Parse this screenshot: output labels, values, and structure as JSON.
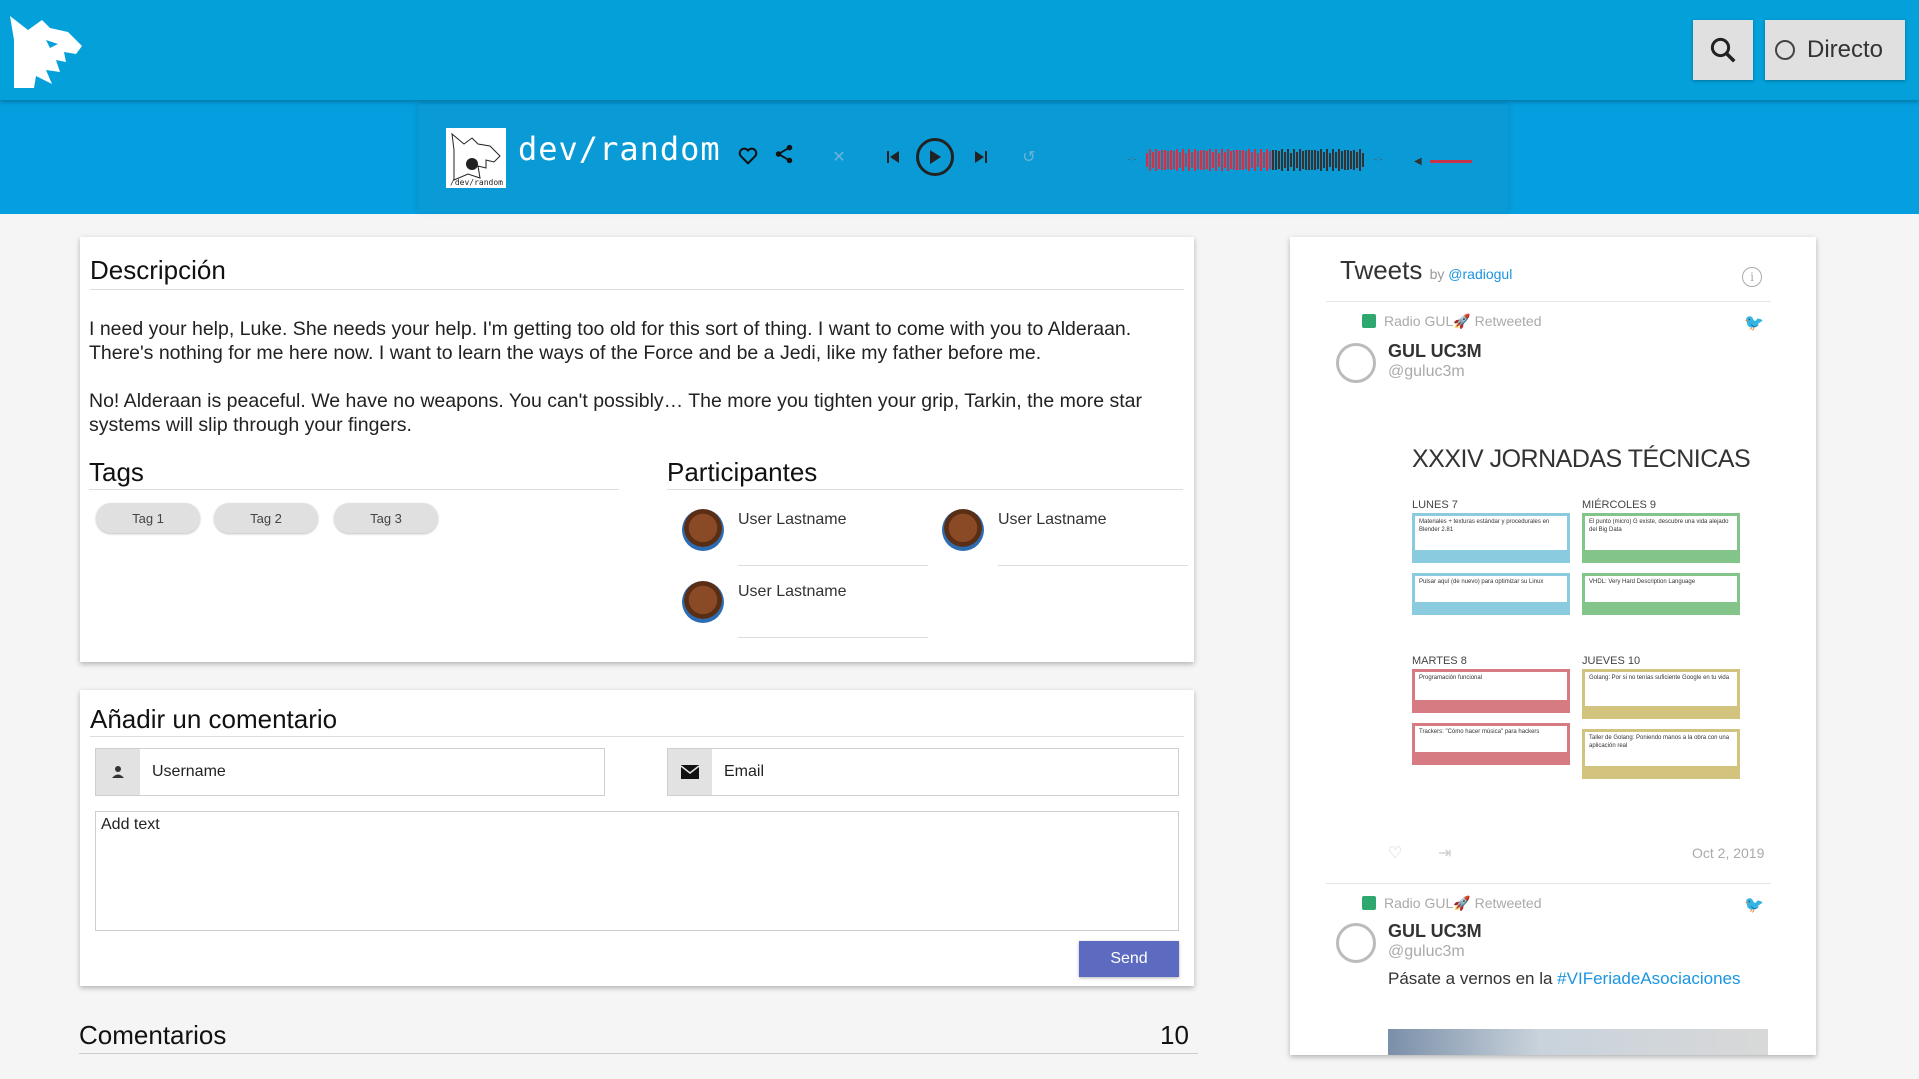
{
  "header": {
    "logo": "lynx-logo",
    "search_icon": "search-icon",
    "live_label": "Directo"
  },
  "player": {
    "cover_caption": "/dev/random",
    "title": "dev/random",
    "time_start": "-:-",
    "time_end": "-:-",
    "colors": {
      "played": "#c8344a",
      "unplayed": "#333333"
    }
  },
  "description": {
    "title": "Descripción",
    "paragraphs": [
      "I need your help, Luke. She needs your help. I'm getting too old for this sort of thing. I want to come with you to Alderaan. There's nothing for me here now. I want to learn the ways of the Force and be a Jedi, like my father before me.",
      "No! Alderaan is peaceful. We have no weapons. You can't possibly… The more you tighten your grip, Tarkin, the more star systems will slip through your fingers."
    ],
    "tags_title": "Tags",
    "tags": [
      "Tag 1",
      "Tag 2",
      "Tag 3"
    ],
    "participants_title": "Participantes",
    "participants": [
      "User Lastname",
      "User Lastname",
      "User Lastname"
    ]
  },
  "comment_form": {
    "title": "Añadir un comentario",
    "username_placeholder": "Username",
    "email_placeholder": "Email",
    "text_placeholder": "Add text",
    "send_label": "Send"
  },
  "comments": {
    "title": "Comentarios",
    "count": "10"
  },
  "tweets": {
    "title": "Tweets",
    "by": "by",
    "handle": "@radiogul",
    "items": [
      {
        "retweeter": "Radio GUL🚀",
        "retweeted": "Retweeted",
        "name": "GUL UC3M",
        "handle": "@guluc3m",
        "media_title": "XXXIV JORNADAS TÉCNICAS",
        "days": [
          "LUNES 7",
          "MIÉRCOLES 9",
          "MARTES 8",
          "JUEVES 10"
        ],
        "talks": [
          "Materiales + texturas estándar y procedurales en Blender 2.81",
          "El punto (micro) G existe, descubre una vida alejado del Big Data",
          "Pulsar aquí (de nuevo) para optimizar su Linux",
          "VHDL: Very Hard Description Language",
          "Programación funcional",
          "Golang: Por si no tenías suficiente Google en tu vida",
          "Trackers: \"Cómo hacer música\" para hackers",
          "Taller de Golang: Poniendo manos a la obra con una aplicación real"
        ],
        "date": "Oct 2, 2019"
      },
      {
        "retweeter": "Radio GUL🚀",
        "retweeted": "Retweeted",
        "name": "GUL UC3M",
        "handle": "@guluc3m",
        "text": "Pásate a vernos en la ",
        "hashtag": "#VIFeriadeAsociaciones"
      }
    ]
  }
}
